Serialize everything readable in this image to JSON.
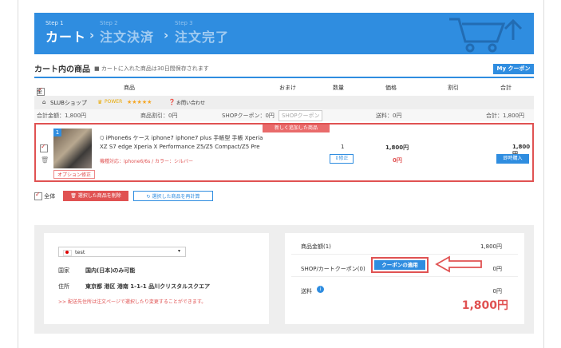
{
  "steps": [
    {
      "num": "Step 1",
      "label": "カート"
    },
    {
      "num": "Step 2",
      "label": "注文決済"
    },
    {
      "num": "Step 3",
      "label": "注文完了"
    }
  ],
  "cart": {
    "title": "カート内の商品",
    "note": "カートに入れた商品は30日間保存されます",
    "my_coupon": "My クーポン"
  },
  "table_headers": {
    "all": "全体",
    "product": "商品",
    "bonus": "おまけ",
    "qty": "数量",
    "price": "価格",
    "discount": "割引",
    "total": "合計"
  },
  "shop": {
    "name": "SLUBショップ",
    "power_label": "POWER",
    "stars": "★★★★★",
    "contact": "お問い合わせ",
    "sum_amount": "合計金額：1,800円",
    "product_discount": "商品割引：0円",
    "shop_coupon": "SHOPクーポン：0円",
    "shop_coupon_btn": "SHOPクーポン",
    "shipping": "送料：0円",
    "total": "合計：1,800円"
  },
  "item": {
    "new_tag": "新しく追加した商品",
    "index": "1",
    "name": "iPhone6s ケース iphone7 iphone7 plus 手帳型 手帳 Xperia XZ S7 edge Xperia X Performance Z5/Z5 Compact/Z5 Pre",
    "variant": "機種対応：iphone6/6s / カラー：シルバー",
    "option_btn": "オプション修正",
    "qty": "1",
    "modify_btn": "修正",
    "price": "1,800円",
    "points": "0円",
    "total": "1,800円",
    "buy_now": "即時購入"
  },
  "actions": {
    "all": "全体",
    "delete_selected": "選択した商品を削除",
    "recalculate": "選択した商品を再計算"
  },
  "address": {
    "select_value": "test",
    "country_label": "国家",
    "country_value": "国内(日本)のみ可能",
    "address_label": "住所",
    "address_value": "東京都 港区 港南 1-1-1 品川クリスタルスクエア",
    "hint": ">> 配送先住所は注文ページで選択したり変更することができます。"
  },
  "summary": {
    "product_amount_label": "商品金額(1)",
    "product_amount_value": "1,800円",
    "coupon_label": "SHOP/カートクーポン(0)",
    "coupon_btn": "クーポンの適用",
    "coupon_value": "0円",
    "shipping_label": "送料",
    "shipping_value": "0円",
    "grand_total": "1,800円"
  },
  "colors": {
    "accent": "#2f8de0",
    "alert": "#e05252"
  }
}
